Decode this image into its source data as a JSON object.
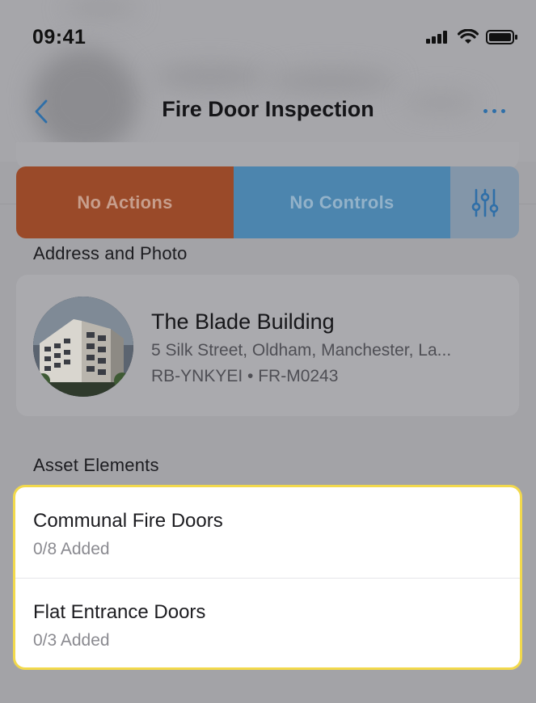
{
  "status_bar": {
    "time": "09:41"
  },
  "nav": {
    "title": "Fire Door Inspection"
  },
  "segments": {
    "actions_label": "No Actions",
    "controls_label": "No Controls"
  },
  "address_section": {
    "label": "Address and Photo",
    "building_name": "The Blade Building",
    "address": "5 Silk Street, Oldham, Manchester, La...",
    "refs": "RB-YNKYEI • FR-M0243"
  },
  "asset_section": {
    "label": "Asset Elements",
    "items": [
      {
        "title": "Communal Fire Doors",
        "count": "0/8 Added"
      },
      {
        "title": "Flat Entrance Doors",
        "count": "0/3 Added"
      }
    ]
  },
  "colors": {
    "actions_segment": "#9a4a29",
    "controls_segment": "#4c85ae",
    "filter_segment": "#8396a9",
    "accent_blue": "#2f6fa8",
    "highlight_border": "#f2d94c"
  },
  "icons": [
    "chevron-left-icon",
    "more-icon",
    "sliders-icon",
    "signal-icon",
    "wifi-icon",
    "battery-icon"
  ]
}
